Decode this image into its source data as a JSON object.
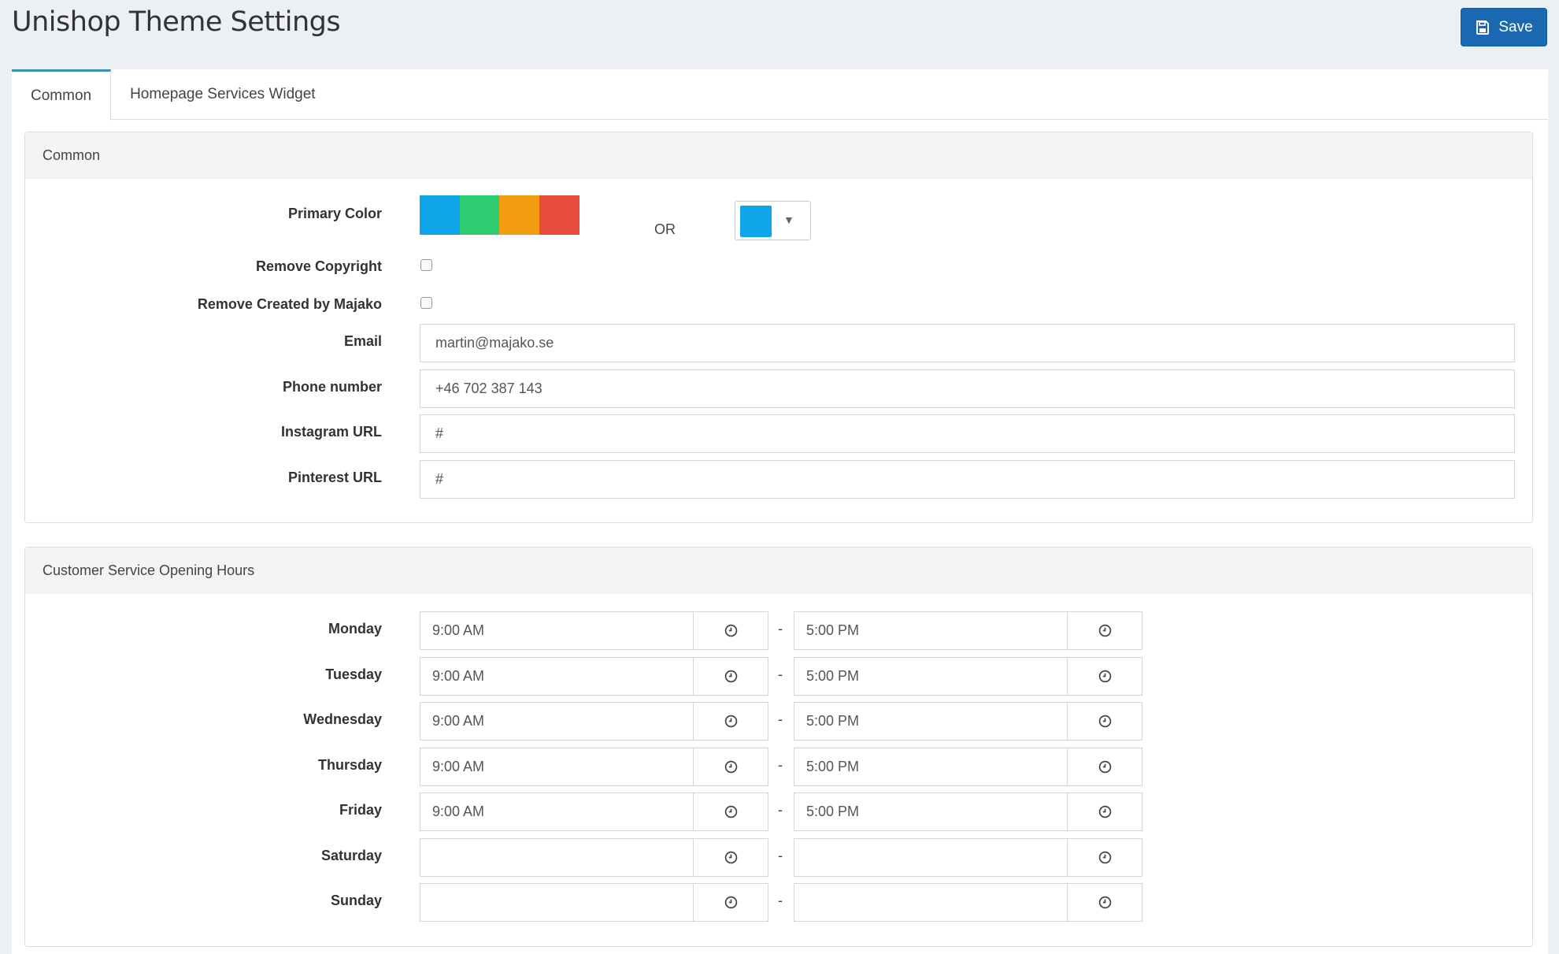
{
  "header": {
    "title": "Unishop Theme Settings",
    "save_label": "Save"
  },
  "tabs": [
    {
      "label": "Common",
      "active": true
    },
    {
      "label": "Homepage Services Widget",
      "active": false
    }
  ],
  "common_panel": {
    "heading": "Common",
    "primary_color_label": "Primary Color",
    "swatches": [
      "#0ea5e9",
      "#2ecc71",
      "#f39c12",
      "#e74c3c"
    ],
    "or_text": "OR",
    "picker_color": "#0ea5e9",
    "remove_copyright_label": "Remove Copyright",
    "remove_copyright_checked": false,
    "remove_created_label": "Remove Created by Majako",
    "remove_created_checked": false,
    "email_label": "Email",
    "email_value": "martin@majako.se",
    "phone_label": "Phone number",
    "phone_value": "+46 702 387 143",
    "instagram_label": "Instagram URL",
    "instagram_value": "#",
    "pinterest_label": "Pinterest URL",
    "pinterest_value": "#"
  },
  "hours_panel": {
    "heading": "Customer Service Opening Hours",
    "separator": "-",
    "days": [
      {
        "day": "Monday",
        "open": "9:00 AM",
        "close": "5:00 PM"
      },
      {
        "day": "Tuesday",
        "open": "9:00 AM",
        "close": "5:00 PM"
      },
      {
        "day": "Wednesday",
        "open": "9:00 AM",
        "close": "5:00 PM"
      },
      {
        "day": "Thursday",
        "open": "9:00 AM",
        "close": "5:00 PM"
      },
      {
        "day": "Friday",
        "open": "9:00 AM",
        "close": "5:00 PM"
      },
      {
        "day": "Saturday",
        "open": "",
        "close": ""
      },
      {
        "day": "Sunday",
        "open": "",
        "close": ""
      }
    ]
  }
}
